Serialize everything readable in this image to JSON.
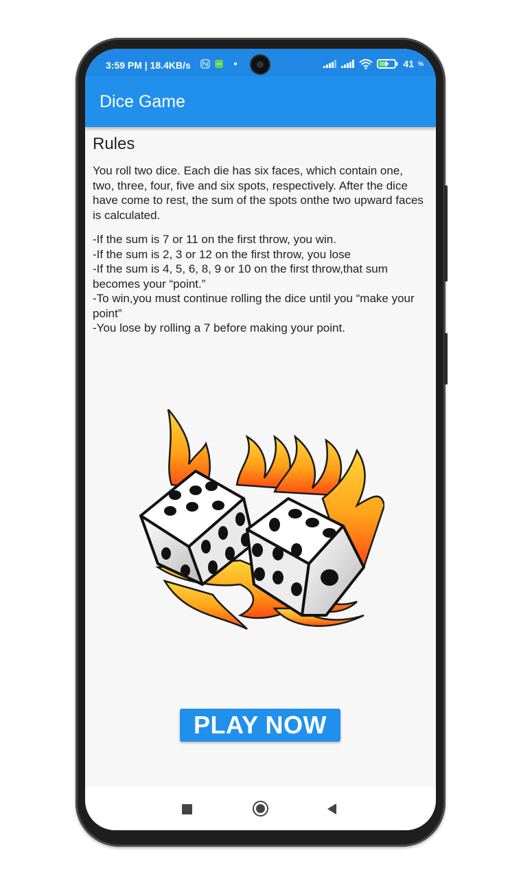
{
  "status_bar": {
    "time": "3:59 PM | 18.4KB/s",
    "battery": "41"
  },
  "app_bar": {
    "title": "Dice Game"
  },
  "rules": {
    "heading": "Rules",
    "intro": "You roll two dice. Each die has six faces, which contain one, two, three, four, five and six spots, respectively. After the dice have come to rest, the sum of the spots onthe two upward faces is calculated.",
    "lines": [
      "-If the sum is 7 or 11 on the first throw, you win.",
      "-If the sum is 2, 3 or 12 on the first throw, you lose",
      "-If the sum is 4, 5, 6, 8, 9 or 10 on the first throw,that sum becomes your “point.”",
      "-To win,you must continue rolling the dice until you “make your point”",
      "-You lose by rolling a 7 before making your point."
    ]
  },
  "play_button": {
    "label": "PLAY NOW"
  },
  "colors": {
    "primary": "#2190ec",
    "status_bar": "#1f88e5",
    "background": "#f7f7f7"
  },
  "icons": {
    "status": [
      "nfc-icon",
      "android-icon",
      "signal-icon",
      "wifi-icon",
      "battery-icon"
    ],
    "nav": [
      "recents-icon",
      "home-icon",
      "back-icon"
    ],
    "illustration": "flaming-dice-illustration"
  }
}
